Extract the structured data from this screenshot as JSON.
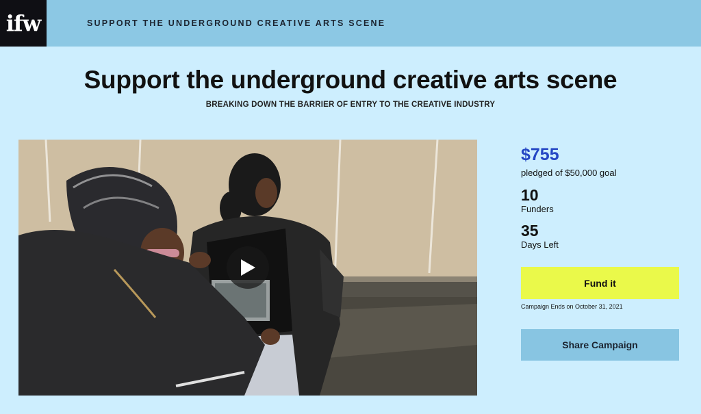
{
  "header": {
    "logo_text": "ifw",
    "title": "SUPPORT THE UNDERGROUND CREATIVE ARTS SCENE"
  },
  "campaign": {
    "title": "Support the underground creative arts scene",
    "subtitle": "BREAKING DOWN THE BARRIER OF ENTRY TO THE CREATIVE INDUSTRY"
  },
  "media": {
    "play_icon": "play-icon"
  },
  "stats": {
    "pledged_amount": "$755",
    "pledged_label": "pledged of $50,000 goal",
    "funders_count": "10",
    "funders_label": "Funders",
    "days_count": "35",
    "days_label": "Days Left"
  },
  "actions": {
    "fund_label": "Fund it",
    "campaign_ends": "Campaign Ends on October 31, 2021",
    "share_label": "Share Campaign"
  },
  "colors": {
    "page_bg": "#cdeefe",
    "header_bg": "#8cc8e4",
    "logo_bg": "#0f0f14",
    "amount": "#2446c4",
    "fund_button": "#eaf94a",
    "share_button": "#88c5e2"
  }
}
